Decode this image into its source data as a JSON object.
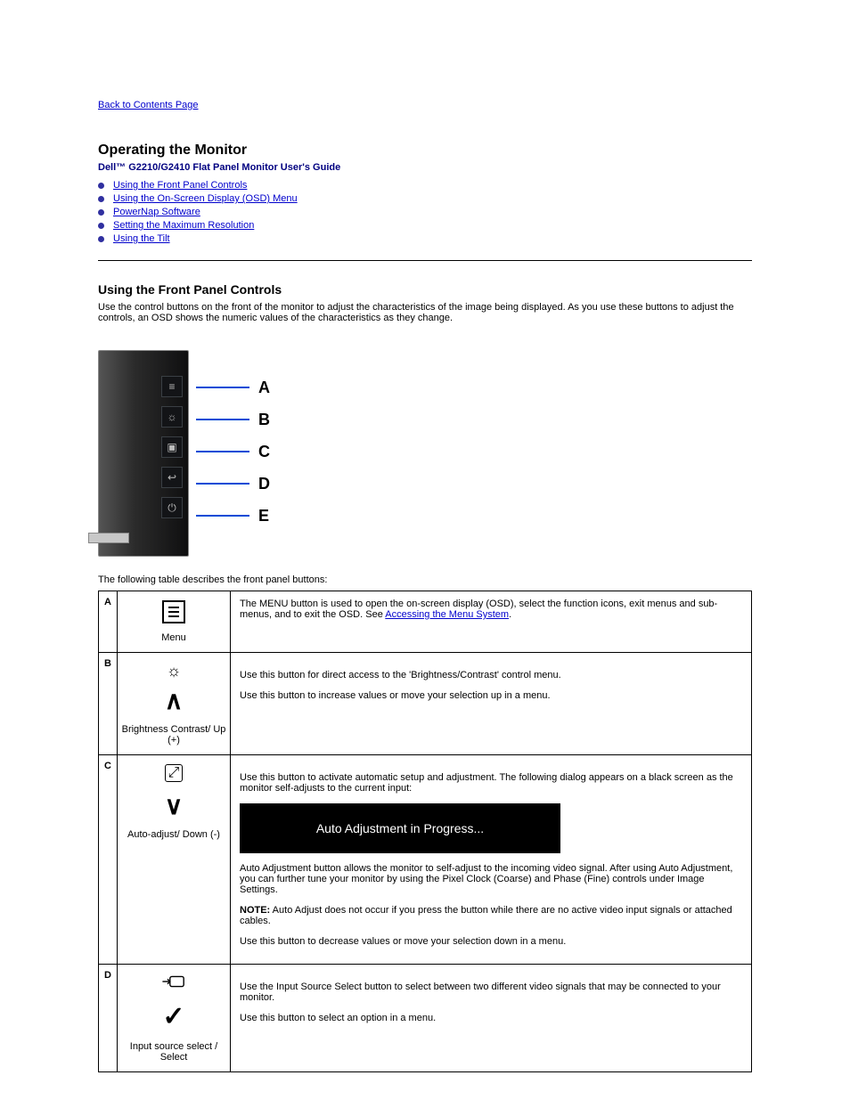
{
  "back_link": "Back to Contents Page",
  "title": "Operating the Monitor",
  "subtitle": "Dell™ G2210/G2410 Flat Panel Monitor User's Guide",
  "toc": [
    "Using the Front Panel Controls",
    "Using the On-Screen Display (OSD) Menu",
    "PowerNap Software",
    "Setting the Maximum Resolution",
    "Using the Tilt"
  ],
  "section_heading": "Using the Front Panel Controls",
  "section_desc": "Use the control buttons on the front of the monitor to adjust the characteristics of the image being displayed. As you use these buttons to adjust the controls, an OSD shows the numeric values of the characteristics as they change.",
  "letters": [
    "A",
    "B",
    "C",
    "D",
    "E"
  ],
  "table_note": "The following table describes the front panel buttons:",
  "panel_icons": [
    "≡",
    "☼",
    "▣",
    "↩",
    "⏻"
  ],
  "rows": {
    "A": {
      "id": "A",
      "icon_label": "Menu",
      "desc": "The MENU button is used to open the on-screen display (OSD), select the function icons, exit menus and sub-menus, and to exit the OSD. See ",
      "link": "Accessing the Menu System",
      "desc_tail": "."
    },
    "B": {
      "id": "B",
      "icon_label": "Brightness Contrast/ Up (+)",
      "desc": "Use this button for direct access to the 'Brightness/Contrast' control menu.",
      "desc2": "Use this button to increase values or move your selection up in a menu."
    },
    "C": {
      "id": "C",
      "icon_label": "Auto-adjust/ Down (-)",
      "desc": "Use this button to activate automatic setup and adjustment. The following dialog appears on a black screen as the monitor self-adjusts to the current input:",
      "banner": "Auto Adjustment in Progress...",
      "desc_after": "Auto Adjustment button allows the monitor to self-adjust to the incoming video signal. After using Auto Adjustment, you can further tune your monitor by using the Pixel Clock (Coarse) and Phase (Fine) controls under Image Settings.",
      "note_label": "NOTE:",
      "note": " Auto Adjust does not occur if you press the button while there are no active video input signals or attached cables.",
      "desc2": "Use this button to decrease values or move your selection down in a menu."
    },
    "D": {
      "id": "D",
      "icon_label": "Input source select / Select",
      "desc": "Use the Input Source Select button to select between two different video signals that may be connected to your monitor.",
      "desc2": "Use this button to select an option in a menu."
    }
  }
}
